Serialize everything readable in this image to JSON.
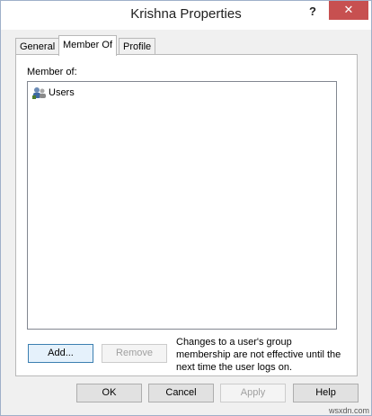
{
  "window": {
    "title": "Krishna Properties",
    "help_glyph": "?",
    "close_glyph": "✕"
  },
  "tabs": [
    {
      "label": "General"
    },
    {
      "label": "Member Of"
    },
    {
      "label": "Profile"
    }
  ],
  "member_of": {
    "label": "Member of:",
    "items": [
      {
        "label": "Users",
        "icon": "group-icon"
      }
    ],
    "add_label": "Add...",
    "remove_label": "Remove",
    "note": "Changes to a user's group membership are not effective until the next time the user logs on."
  },
  "footer": {
    "ok_label": "OK",
    "cancel_label": "Cancel",
    "apply_label": "Apply",
    "help_label": "Help"
  },
  "watermark": "wsxdn.com"
}
